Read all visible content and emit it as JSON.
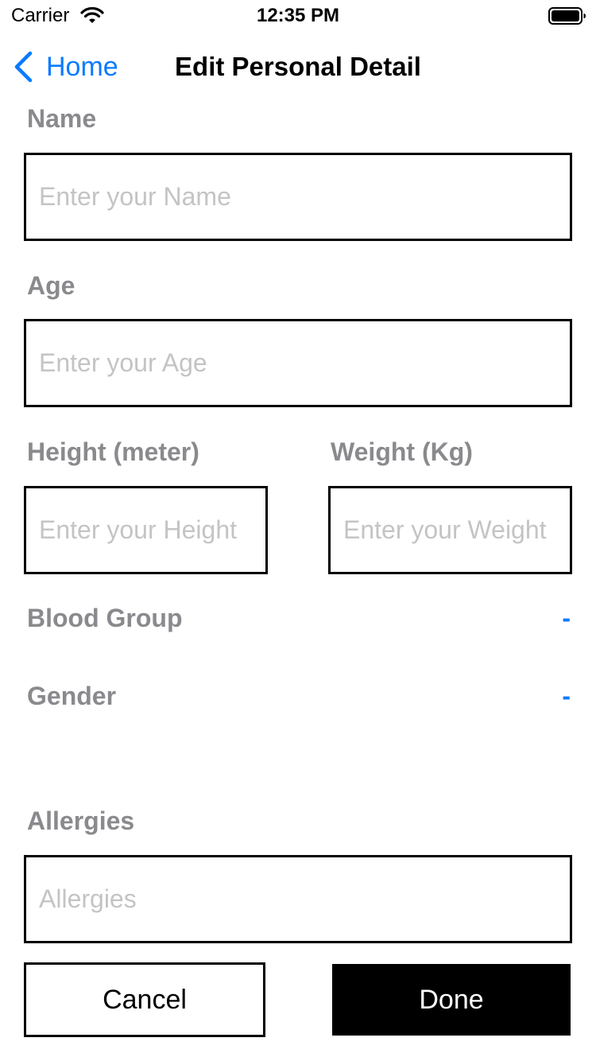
{
  "status_bar": {
    "carrier": "Carrier",
    "time": "12:35 PM",
    "wifi_icon": "wifi-icon",
    "battery_icon": "battery-icon"
  },
  "nav": {
    "back_label": "Home",
    "back_icon": "chevron-left-icon",
    "title": "Edit Personal Detail"
  },
  "form": {
    "name": {
      "label": "Name",
      "placeholder": "Enter your Name",
      "value": ""
    },
    "age": {
      "label": "Age",
      "placeholder": "Enter your Age",
      "value": ""
    },
    "height": {
      "label": "Height (meter)",
      "placeholder": "Enter your Height",
      "value": ""
    },
    "weight": {
      "label": "Weight (Kg)",
      "placeholder": "Enter your Weight",
      "value": ""
    },
    "blood_group": {
      "label": "Blood Group",
      "value": "-"
    },
    "gender": {
      "label": "Gender",
      "value": "-"
    },
    "allergies": {
      "label": "Allergies",
      "placeholder": "Allergies",
      "value": ""
    }
  },
  "actions": {
    "cancel_label": "Cancel",
    "done_label": "Done"
  },
  "colors": {
    "accent": "#0a7aff",
    "label_gray": "#8a8a8e",
    "placeholder_gray": "#c4c4c6",
    "border": "#000000",
    "done_background": "#000000"
  }
}
